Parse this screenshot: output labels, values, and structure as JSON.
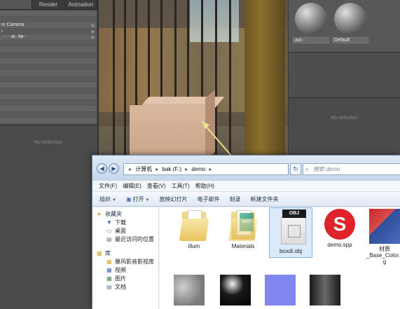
{
  "left_panel": {
    "tabs": [
      "",
      "Render",
      "Animation"
    ],
    "rows": [
      "",
      "",
      "in Camera",
      "i",
      "······ai··fai··",
      "",
      "",
      "",
      "",
      "",
      "",
      "",
      "",
      "",
      "",
      "",
      "",
      "",
      ""
    ],
    "no_selection": "No Selection"
  },
  "right_panel": {
    "materials": [
      {
        "label": "aoi···"
      },
      {
        "label": "Default"
      }
    ],
    "no_selection": "No selection"
  },
  "explorer": {
    "address": [
      "计算机",
      "bak (F:)",
      "demo"
    ],
    "search_placeholder": "搜索 demo",
    "menu": [
      "文件(F)",
      "编辑(E)",
      "查看(V)",
      "工具(T)",
      "帮助(H)"
    ],
    "toolbar": [
      "组织",
      "打开",
      "放映幻灯片",
      "电子邮件",
      "刻录",
      "新建文件夹"
    ],
    "nav": {
      "favorites_label": "收藏夹",
      "favorites": [
        "下载",
        "桌面",
        "最近访问的位置"
      ],
      "library_label": "库",
      "library": [
        "暴风影音影视库",
        "视频",
        "图片",
        "文档"
      ]
    },
    "files": [
      {
        "name": "illum",
        "type": "folder"
      },
      {
        "name": "Materials",
        "type": "folder"
      },
      {
        "name": "boxdi.obj",
        "type": "obj",
        "selected": true
      },
      {
        "name": "demo.spp",
        "type": "spp"
      },
      {
        "name": "材质_Base_Color.p\ng",
        "type": "image"
      }
    ],
    "mat_badge": "MAT",
    "obj_badge": "OBJ"
  },
  "icons": {
    "back": "back-arrow-icon",
    "forward": "forward-arrow-icon",
    "refresh": "refresh-icon",
    "search": "search-icon"
  }
}
